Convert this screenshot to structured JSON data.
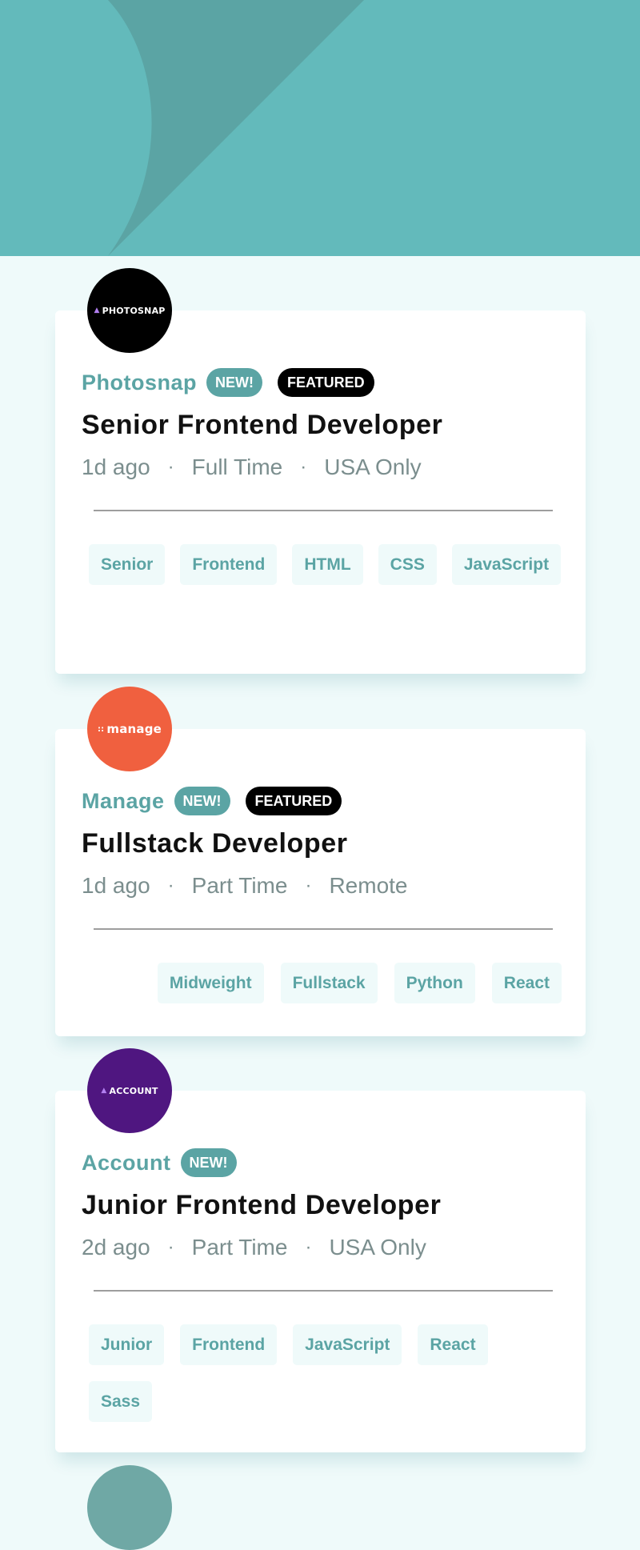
{
  "jobs": [
    {
      "logo": "PHOTOSNAP",
      "logo_color": "#000000",
      "company": "Photosnap",
      "new": "NEW!",
      "featured": "FEATURED",
      "position": "Senior Frontend Developer",
      "posted": "1d ago",
      "contract": "Full Time",
      "location": "USA Only",
      "tags": [
        "Senior",
        "Frontend",
        "HTML",
        "CSS",
        "JavaScript"
      ]
    },
    {
      "logo": "manage",
      "logo_color": "#f0603f",
      "company": "Manage",
      "new": "NEW!",
      "featured": "FEATURED",
      "position": "Fullstack Developer",
      "posted": "1d ago",
      "contract": "Part Time",
      "location": "Remote",
      "tags": [
        "Midweight",
        "Fullstack",
        "Python",
        "React"
      ]
    },
    {
      "logo": "ACCOUNT",
      "logo_color": "#4f1680",
      "company": "Account",
      "new": "NEW!",
      "position": "Junior Frontend Developer",
      "posted": "2d ago",
      "contract": "Part Time",
      "location": "USA Only",
      "tags": [
        "Junior",
        "Frontend",
        "JavaScript",
        "React",
        "Sass"
      ]
    }
  ],
  "separator": "·",
  "colors": {
    "header": "#63babb",
    "primary": "#5ba4a4",
    "background": "#effafa"
  }
}
